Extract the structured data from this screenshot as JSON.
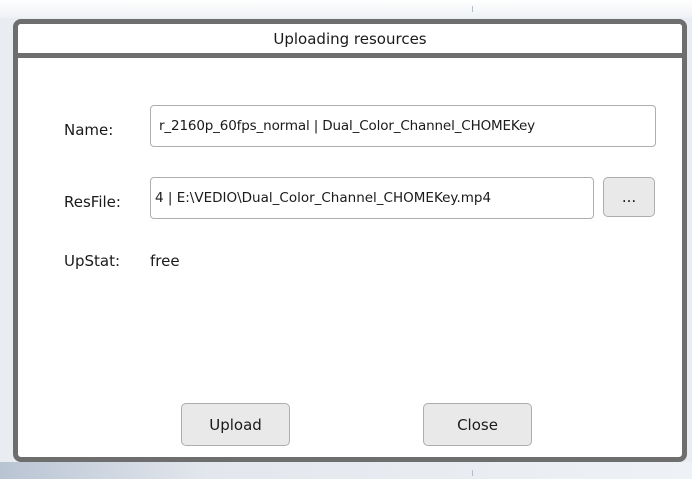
{
  "dialog": {
    "title": "Uploading resources",
    "name_label": "Name:",
    "name_value": "r_2160p_60fps_normal | Dual_Color_Channel_CHOMEKey",
    "resfile_label": "ResFile:",
    "resfile_value": "4 | E:\\VEDIO\\Dual_Color_Channel_CHOMEKey.mp4",
    "browse_label": "...",
    "upstat_label": "UpStat:",
    "upstat_value": "free",
    "upload_label": "Upload",
    "close_label": "Close"
  },
  "colors": {
    "frame": "#6e6e6e",
    "button_bg": "#e9e9e9",
    "field_border": "#adadad"
  }
}
